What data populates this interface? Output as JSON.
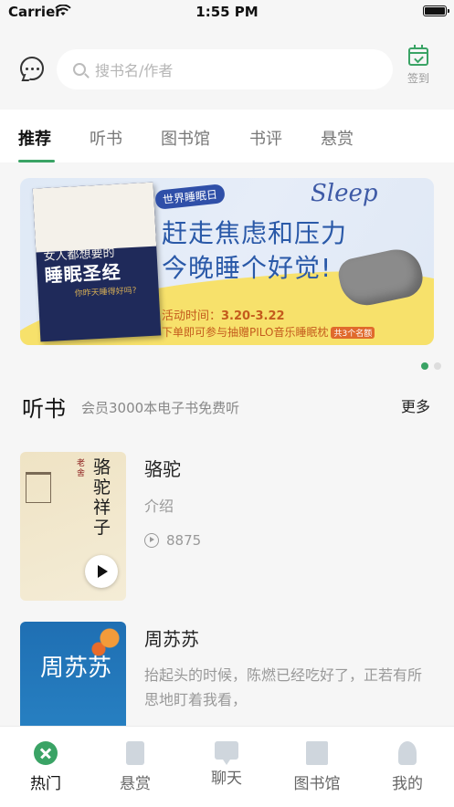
{
  "status_bar": {
    "carrier": "Carrier",
    "time": "1:55 PM"
  },
  "header": {
    "search_placeholder": "搜书名/作者",
    "checkin_label": "签到",
    "accent_color": "#3aa365"
  },
  "tabs": [
    {
      "label": "推荐",
      "active": true
    },
    {
      "label": "听书",
      "active": false
    },
    {
      "label": "图书馆",
      "active": false
    },
    {
      "label": "书评",
      "active": false
    },
    {
      "label": "悬赏",
      "active": false
    }
  ],
  "banner": {
    "badge": "世界睡眠日",
    "sleep_word": "Sleep",
    "headline_1": "赶走焦虑和压力",
    "headline_2": "今晚睡个好觉!",
    "time_label": "活动时间：",
    "time_value": "3.20-3.22",
    "draw_text": "下单即可参与抽赠PILO音乐睡眠枕",
    "draw_tag": "共3个名额",
    "book_subtitle": "女人都想要的",
    "book_title": "睡眠圣经",
    "book_question": "你昨天睡得好吗?",
    "page_count": 2,
    "active_page": 1
  },
  "section": {
    "title": "听书",
    "subtitle": "会员3000本电子书免费听",
    "more": "更多"
  },
  "books": [
    {
      "title": "骆驼",
      "desc": "介绍",
      "plays": "8875",
      "cover_text": "骆驼祥子",
      "cover_author": "老舍"
    },
    {
      "title": "周苏苏",
      "desc": "抬起头的时候，陈燃已经吃好了，正若有所思地盯着我看，",
      "cover_text": "周苏苏"
    }
  ],
  "bottom_nav": [
    {
      "label": "热门",
      "icon": "hot-icon",
      "active": true
    },
    {
      "label": "悬赏",
      "icon": "reward-icon",
      "active": false
    },
    {
      "label": "聊天",
      "icon": "chat-icon",
      "active": false
    },
    {
      "label": "图书馆",
      "icon": "library-icon",
      "active": false
    },
    {
      "label": "我的",
      "icon": "profile-icon",
      "active": false
    }
  ]
}
